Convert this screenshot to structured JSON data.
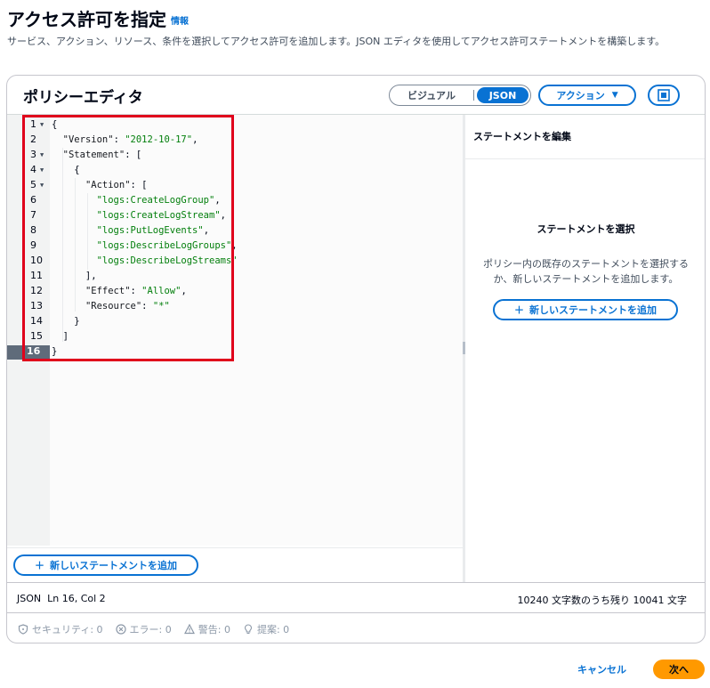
{
  "header": {
    "title": "アクセス許可を指定",
    "info_link": "情報",
    "description": "サービス、アクション、リソース、条件を選択してアクセス許可を追加します。JSON エディタを使用してアクセス許可ステートメントを構築します。"
  },
  "editor": {
    "title": "ポリシーエディタ",
    "mode_visual": "ビジュアル",
    "mode_json": "JSON",
    "actions_label": "アクション",
    "code_lines": [
      {
        "num": "1",
        "text": "{"
      },
      {
        "num": "2",
        "text": "  \"Version\": \"2012-10-17\","
      },
      {
        "num": "3",
        "text": "  \"Statement\": ["
      },
      {
        "num": "4",
        "text": "    {"
      },
      {
        "num": "5",
        "text": "      \"Action\": ["
      },
      {
        "num": "6",
        "text": "        \"logs:CreateLogGroup\","
      },
      {
        "num": "7",
        "text": "        \"logs:CreateLogStream\","
      },
      {
        "num": "8",
        "text": "        \"logs:PutLogEvents\","
      },
      {
        "num": "9",
        "text": "        \"logs:DescribeLogGroups\","
      },
      {
        "num": "10",
        "text": "        \"logs:DescribeLogStreams\""
      },
      {
        "num": "11",
        "text": "      ],"
      },
      {
        "num": "12",
        "text": "      \"Effect\": \"Allow\","
      },
      {
        "num": "13",
        "text": "      \"Resource\": \"*\""
      },
      {
        "num": "14",
        "text": "    }"
      },
      {
        "num": "15",
        "text": "  ]"
      },
      {
        "num": "16",
        "text": "}"
      }
    ],
    "add_statement_label": "新しいステートメントを追加"
  },
  "side_panel": {
    "header": "ステートメントを編集",
    "select_title": "ステートメントを選択",
    "select_desc": "ポリシー内の既存のステートメントを選択するか、新しいステートメントを追加します。",
    "add_statement_label": "新しいステートメントを追加"
  },
  "status": {
    "mode": "JSON",
    "position": "Ln 16, Col 2",
    "chars_remaining": "10240 文字数のうち残り 10041 文字"
  },
  "validation": {
    "security": "セキュリティ: 0",
    "errors": "エラー: 0",
    "warnings": "警告: 0",
    "suggestions": "提案: 0"
  },
  "footer": {
    "cancel": "キャンセル",
    "next": "次へ"
  },
  "colors": {
    "accent": "#0972d3",
    "primary_button": "#ff9900",
    "highlight_box": "#e0001b",
    "string": "#037f0c"
  }
}
